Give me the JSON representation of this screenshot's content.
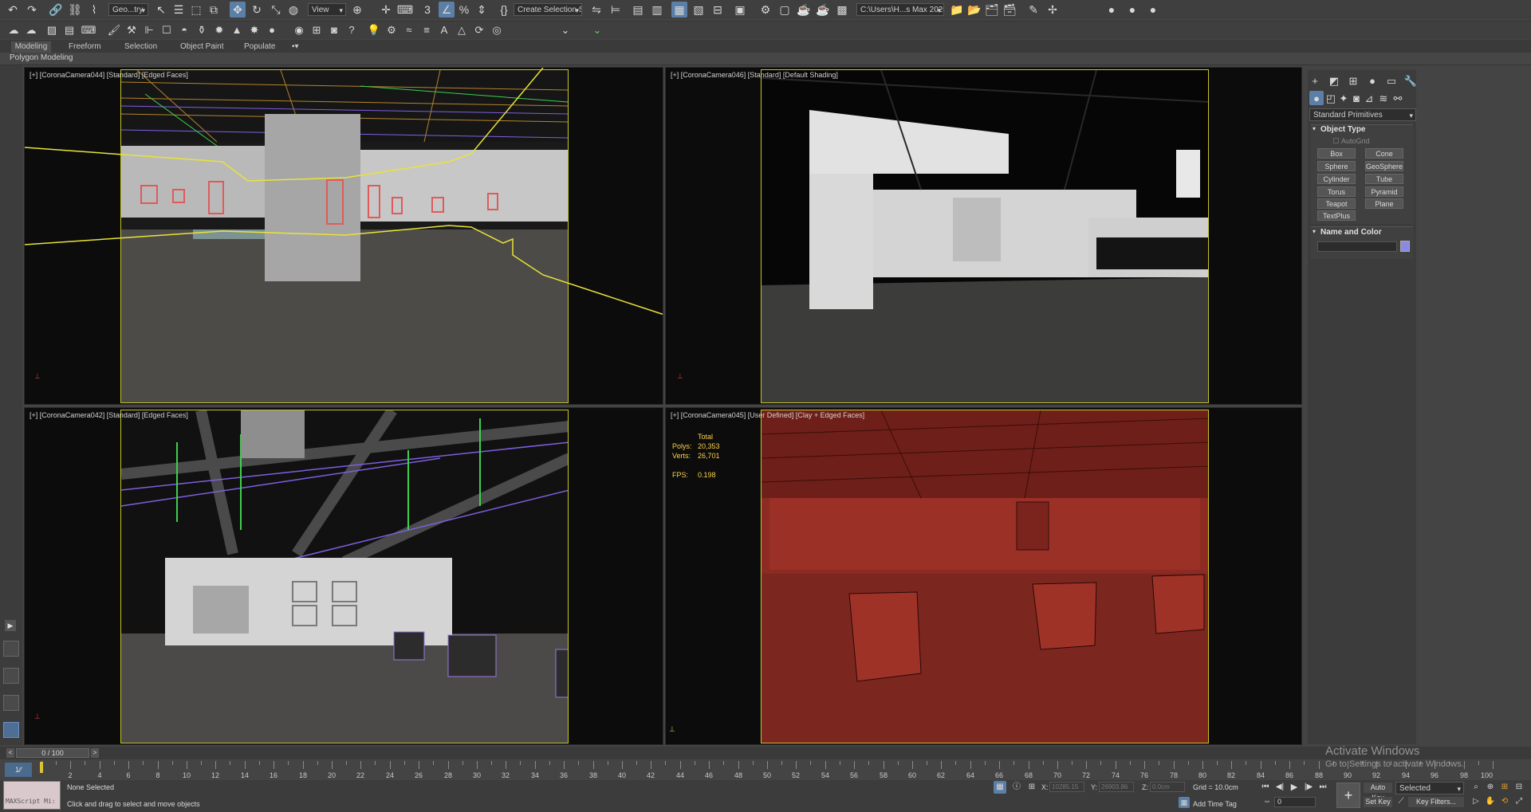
{
  "toolbar_main": {
    "selection_filter": "Geo...try",
    "ref_coord": "View",
    "named_selection": "Create Selection Se",
    "project_path": "C:\\Users\\H...s Max 2020"
  },
  "ribbon": {
    "tabs": [
      "Modeling",
      "Freeform",
      "Selection",
      "Object Paint",
      "Populate"
    ],
    "panel_label": "Polygon Modeling"
  },
  "viewports": [
    {
      "label": "[+] [CoronaCamera044] [Standard] [Edged Faces]"
    },
    {
      "label": "[+] [CoronaCamera046] [Standard] [Default Shading]"
    },
    {
      "label": "[+] [CoronaCamera042] [Standard] [Edged Faces]"
    },
    {
      "label": "[+] [CoronaCamera045] [User Defined] [Clay + Edged Faces]"
    }
  ],
  "stats": {
    "total_label": "Total",
    "polys_label": "Polys:",
    "polys_value": "20,353",
    "verts_label": "Verts:",
    "verts_value": "26,701",
    "fps_label": "FPS:",
    "fps_value": "0.198"
  },
  "command_panel": {
    "category": "Standard Primitives",
    "object_type_title": "Object Type",
    "autogrid": "AutoGrid",
    "buttons": [
      "Box",
      "Cone",
      "Sphere",
      "GeoSphere",
      "Cylinder",
      "Tube",
      "Torus",
      "Pyramid",
      "Teapot",
      "Plane",
      "TextPlus"
    ],
    "name_color_title": "Name and Color",
    "swatch_color": "#8a8ae0"
  },
  "timeline": {
    "frame_display": "0 / 100",
    "ticks": [
      "0",
      "2",
      "4",
      "6",
      "8",
      "10",
      "12",
      "14",
      "16",
      "18",
      "20",
      "22",
      "24",
      "26",
      "28",
      "30",
      "32",
      "34",
      "36",
      "38",
      "40",
      "42",
      "44",
      "46",
      "48",
      "50",
      "52",
      "54",
      "56",
      "58",
      "60",
      "62",
      "64",
      "66",
      "68",
      "70",
      "72",
      "74",
      "76",
      "78",
      "80",
      "82",
      "84",
      "86",
      "88",
      "90",
      "92",
      "94",
      "96",
      "98",
      "100"
    ]
  },
  "status": {
    "maxscript": "MAXScript Mi:",
    "selection": "None Selected",
    "prompt": "Click and drag to select and move objects",
    "x_label": "X:",
    "x_value": "10285.15",
    "y_label": "Y:",
    "y_value": "26903.86",
    "z_label": "Z:",
    "z_value": "0.0cm",
    "grid": "Grid = 10.0cm",
    "add_time_tag": "Add Time Tag",
    "auto_key": "Auto Key",
    "set_key": "Set Key",
    "key_mode": "Selected",
    "key_filters": "Key Filters...",
    "frame_field": "0"
  },
  "watermark": {
    "title": "Activate Windows",
    "subtitle": "Go to Settings to activate Windows."
  },
  "colors": {
    "selection_yellow": "#c9c42a",
    "clay_red": "#8d2a22",
    "accent_blue": "#5b7fa6"
  }
}
